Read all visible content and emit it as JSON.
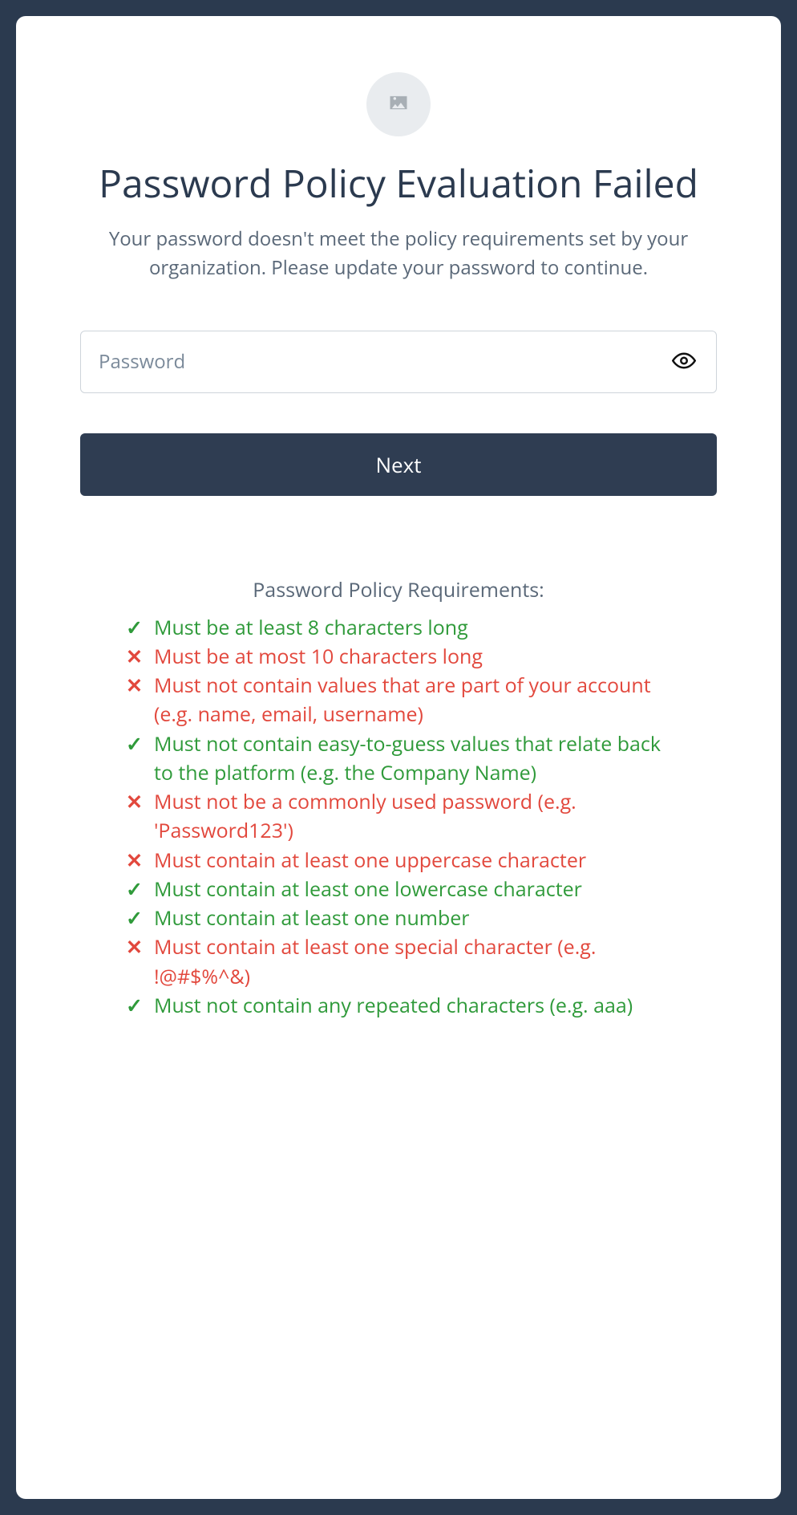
{
  "header": {
    "title": "Password Policy Evaluation Failed",
    "subtitle": "Your password doesn't meet the policy requirements set by your organization. Please update your password to continue."
  },
  "form": {
    "password_placeholder": "Password",
    "next_label": "Next"
  },
  "policy": {
    "title": "Password Policy Requirements:",
    "items": [
      {
        "status": "pass",
        "text": "Must be at least 8 characters long"
      },
      {
        "status": "fail",
        "text": "Must be at most 10 characters long"
      },
      {
        "status": "fail",
        "text": "Must not contain values that are part of your account (e.g. name, email, username)"
      },
      {
        "status": "pass",
        "text": "Must not contain easy-to-guess values that relate back to the platform (e.g. the Company Name)"
      },
      {
        "status": "fail",
        "text": "Must not be a commonly used password (e.g. 'Password123')"
      },
      {
        "status": "fail",
        "text": "Must contain at least one uppercase character"
      },
      {
        "status": "pass",
        "text": "Must contain at least one lowercase character"
      },
      {
        "status": "pass",
        "text": "Must contain at least one number"
      },
      {
        "status": "fail",
        "text": "Must contain at least one special character (e.g. !@#$%^&)"
      },
      {
        "status": "pass",
        "text": "Must not contain any repeated characters (e.g. aaa)"
      }
    ]
  },
  "marks": {
    "pass": "✓",
    "fail": "✕"
  }
}
